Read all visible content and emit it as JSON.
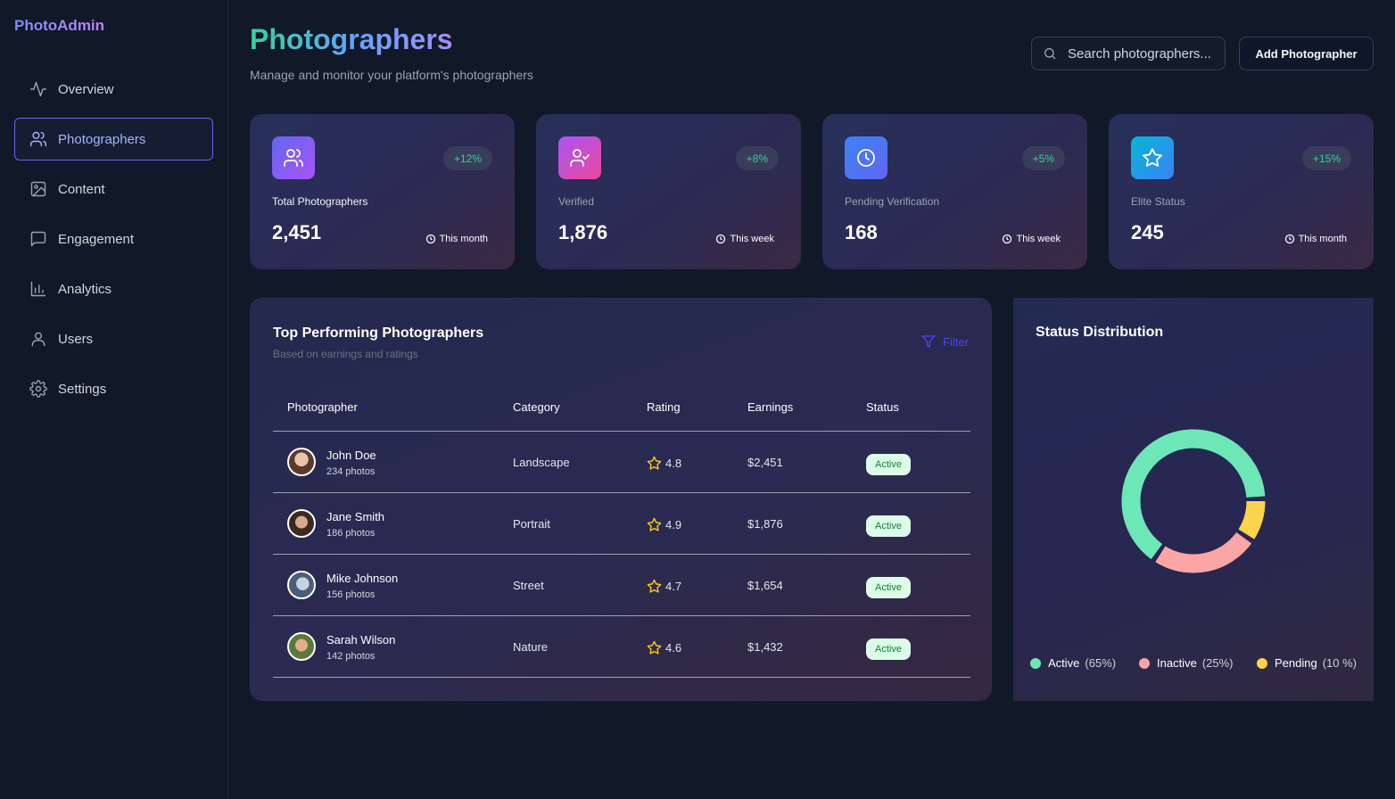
{
  "sidebar": {
    "brand": "PhotoAdmin",
    "items": [
      {
        "label": "Overview",
        "icon": "activity-icon"
      },
      {
        "label": "Photographers",
        "icon": "users-icon",
        "active": true
      },
      {
        "label": "Content",
        "icon": "image-icon"
      },
      {
        "label": "Engagement",
        "icon": "message-icon"
      },
      {
        "label": "Analytics",
        "icon": "bar-chart-icon"
      },
      {
        "label": "Users",
        "icon": "user-icon"
      },
      {
        "label": "Settings",
        "icon": "gear-icon"
      }
    ]
  },
  "header": {
    "title": "Photographers",
    "subtitle": "Manage and monitor your platform's photographers",
    "search_placeholder": "Search photographers...",
    "add_button": "Add Photographer"
  },
  "stats": [
    {
      "label": "Total Photographers",
      "value": "2,451",
      "change": "+12%",
      "period": "This month",
      "icon": "users-icon",
      "color_from": "#6366f1",
      "color_to": "#a855f7"
    },
    {
      "label": "Verified",
      "value": "1,876",
      "change": "+8%",
      "period": "This week",
      "icon": "user-check-icon",
      "color_from": "#a855f7",
      "color_to": "#ec4899"
    },
    {
      "label": "Pending Verification",
      "value": "168",
      "change": "+5%",
      "period": "This week",
      "icon": "clock-icon",
      "color_from": "#3b82f6",
      "color_to": "#6366f1"
    },
    {
      "label": "Elite Status",
      "value": "245",
      "change": "+15%",
      "period": "This month",
      "icon": "star-icon",
      "color_from": "#06b6d4",
      "color_to": "#3b82f6"
    }
  ],
  "table": {
    "title": "Top Performing Photographers",
    "subtitle": "Based on earnings and ratings",
    "filter_label": "Filter",
    "columns": [
      "Photographer",
      "Category",
      "Rating",
      "Earnings",
      "Status"
    ],
    "rows": [
      {
        "name": "John Doe",
        "photos": "234  photos",
        "category": "Landscape",
        "rating": "4.8",
        "earnings": "$2,451",
        "status": "Active"
      },
      {
        "name": "Jane Smith",
        "photos": "186  photos",
        "category": "Portrait",
        "rating": "4.9",
        "earnings": "$1,876",
        "status": "Active"
      },
      {
        "name": "Mike Johnson",
        "photos": "156  photos",
        "category": "Street",
        "rating": "4.7",
        "earnings": "$1,654",
        "status": "Active"
      },
      {
        "name": "Sarah Wilson",
        "photos": "142  photos",
        "category": "Nature",
        "rating": "4.6",
        "earnings": "$1,432",
        "status": "Active"
      }
    ]
  },
  "distribution": {
    "title": "Status Distribution",
    "segments": [
      {
        "label": "Active",
        "pct_label": "(65%)",
        "value": 65,
        "color": "#6ee7b7"
      },
      {
        "label": "Inactive",
        "pct_label": "(25%)",
        "value": 25,
        "color": "#fca5a5"
      },
      {
        "label": "Pending",
        "pct_label": "(10 %)",
        "value": 10,
        "color": "#fcd34d"
      }
    ]
  }
}
